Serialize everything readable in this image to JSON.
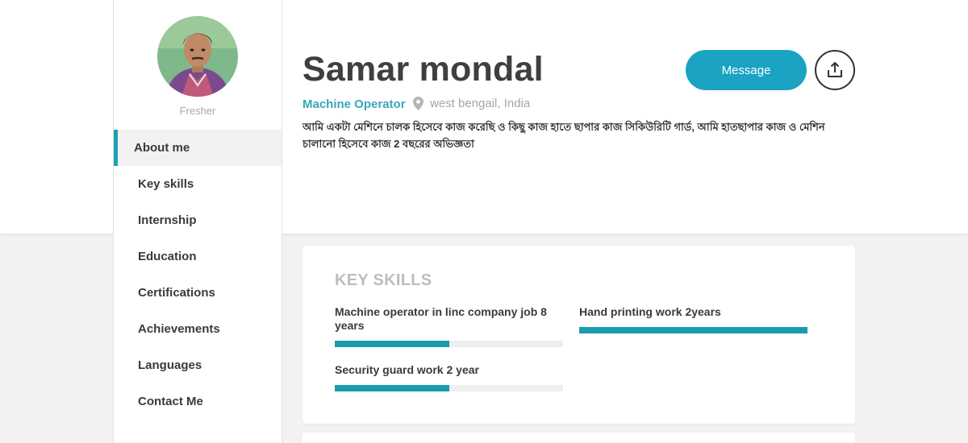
{
  "sidebar": {
    "avatar_alt": "profile photo",
    "status": "Fresher",
    "nav": [
      {
        "label": "About me",
        "active": true
      },
      {
        "label": "Key skills"
      },
      {
        "label": "Internship"
      },
      {
        "label": "Education"
      },
      {
        "label": "Certifications"
      },
      {
        "label": "Achievements"
      },
      {
        "label": "Languages"
      },
      {
        "label": "Contact Me"
      }
    ]
  },
  "profile": {
    "name": "Samar mondal",
    "title": "Machine Operator",
    "location": "west bengail, India",
    "location_icon": "map-pin-icon",
    "bio": "আমি একটা মেশিনে চালক হিসেবে কাজ করেছি ও কিছু কাজ হাতে ছাপার কাজ সিকিউরিটি গার্ড, আমি হাতছাপার কাজ ও মেশিন চালানো হিসেবে কাজ 2 বছরের অভিজ্ঞতা"
  },
  "actions": {
    "message": "Message",
    "share_icon": "share-upload-icon"
  },
  "key_skills": {
    "title": "KEY SKILLS",
    "items": [
      {
        "label": "Machine operator in linc company job 8 years",
        "level": 0.5
      },
      {
        "label": "Hand printing work 2years",
        "level": 1.0
      },
      {
        "label": "Security guard work 2 year",
        "level": 0.5
      }
    ]
  },
  "colors": {
    "accent": "#1aa3c3",
    "skill_bar": "#1a9bb0",
    "title_accent": "#37a7bb"
  }
}
